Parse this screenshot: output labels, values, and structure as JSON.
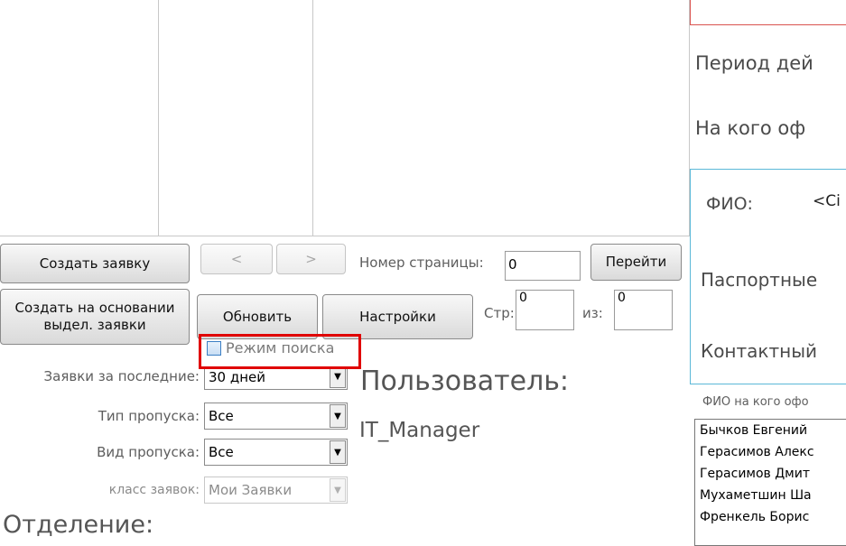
{
  "toolbar": {
    "create_request": "Создать заявку",
    "prev": "<",
    "next": ">",
    "page_number_label": "Номер страницы:",
    "page_number_value": "0",
    "go": "Перейти",
    "create_based_on": "Создать на основании\nвыдел. заявки",
    "refresh": "Обновить",
    "settings": "Настройки",
    "page_label": "Стр:",
    "page_value": "0",
    "of_label": "из:",
    "of_value": "0"
  },
  "search_mode": {
    "label": "Режим поиска",
    "checked": false
  },
  "filters": {
    "recent_label": "Заявки за последние:",
    "recent_value": "30 дней",
    "pass_type_label": "Тип пропуска:",
    "pass_type_value": "Все",
    "pass_kind_label": "Вид пропуска:",
    "pass_kind_value": "Все",
    "request_class_label": "класс заявок:",
    "request_class_value": "Мои Заявки"
  },
  "user": {
    "label": "Пользователь:",
    "name": "IT_Manager"
  },
  "department_label": "Отделение:",
  "right_panel": {
    "period": "Период дей",
    "for_whom": "На кого оф",
    "fio_label": "ФИО:",
    "fio_value": "<Сі",
    "passport": "Паспортные",
    "contact": "Контактный",
    "list_header": "ФИО на кого офо",
    "list_items": [
      "Бычков Евгений",
      "Герасимов Алекс",
      "Герасимов Дмит",
      "Мухаметшин Ша",
      "Френкель Борис"
    ]
  },
  "colors": {
    "highlight_box": "#e00000",
    "accent_border": "#5bb8d8",
    "top_box_border": "#d9534f"
  }
}
